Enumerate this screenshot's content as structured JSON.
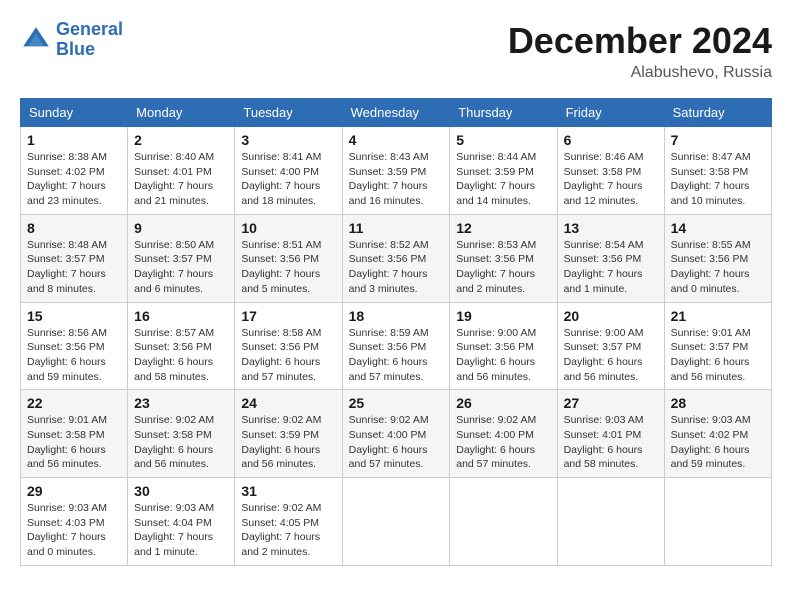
{
  "header": {
    "logo_line1": "General",
    "logo_line2": "Blue",
    "month": "December 2024",
    "location": "Alabushevo, Russia"
  },
  "days_of_week": [
    "Sunday",
    "Monday",
    "Tuesday",
    "Wednesday",
    "Thursday",
    "Friday",
    "Saturday"
  ],
  "weeks": [
    [
      {
        "num": "1",
        "info": "Sunrise: 8:38 AM\nSunset: 4:02 PM\nDaylight: 7 hours\nand 23 minutes."
      },
      {
        "num": "2",
        "info": "Sunrise: 8:40 AM\nSunset: 4:01 PM\nDaylight: 7 hours\nand 21 minutes."
      },
      {
        "num": "3",
        "info": "Sunrise: 8:41 AM\nSunset: 4:00 PM\nDaylight: 7 hours\nand 18 minutes."
      },
      {
        "num": "4",
        "info": "Sunrise: 8:43 AM\nSunset: 3:59 PM\nDaylight: 7 hours\nand 16 minutes."
      },
      {
        "num": "5",
        "info": "Sunrise: 8:44 AM\nSunset: 3:59 PM\nDaylight: 7 hours\nand 14 minutes."
      },
      {
        "num": "6",
        "info": "Sunrise: 8:46 AM\nSunset: 3:58 PM\nDaylight: 7 hours\nand 12 minutes."
      },
      {
        "num": "7",
        "info": "Sunrise: 8:47 AM\nSunset: 3:58 PM\nDaylight: 7 hours\nand 10 minutes."
      }
    ],
    [
      {
        "num": "8",
        "info": "Sunrise: 8:48 AM\nSunset: 3:57 PM\nDaylight: 7 hours\nand 8 minutes."
      },
      {
        "num": "9",
        "info": "Sunrise: 8:50 AM\nSunset: 3:57 PM\nDaylight: 7 hours\nand 6 minutes."
      },
      {
        "num": "10",
        "info": "Sunrise: 8:51 AM\nSunset: 3:56 PM\nDaylight: 7 hours\nand 5 minutes."
      },
      {
        "num": "11",
        "info": "Sunrise: 8:52 AM\nSunset: 3:56 PM\nDaylight: 7 hours\nand 3 minutes."
      },
      {
        "num": "12",
        "info": "Sunrise: 8:53 AM\nSunset: 3:56 PM\nDaylight: 7 hours\nand 2 minutes."
      },
      {
        "num": "13",
        "info": "Sunrise: 8:54 AM\nSunset: 3:56 PM\nDaylight: 7 hours\nand 1 minute."
      },
      {
        "num": "14",
        "info": "Sunrise: 8:55 AM\nSunset: 3:56 PM\nDaylight: 7 hours\nand 0 minutes."
      }
    ],
    [
      {
        "num": "15",
        "info": "Sunrise: 8:56 AM\nSunset: 3:56 PM\nDaylight: 6 hours\nand 59 minutes."
      },
      {
        "num": "16",
        "info": "Sunrise: 8:57 AM\nSunset: 3:56 PM\nDaylight: 6 hours\nand 58 minutes."
      },
      {
        "num": "17",
        "info": "Sunrise: 8:58 AM\nSunset: 3:56 PM\nDaylight: 6 hours\nand 57 minutes."
      },
      {
        "num": "18",
        "info": "Sunrise: 8:59 AM\nSunset: 3:56 PM\nDaylight: 6 hours\nand 57 minutes."
      },
      {
        "num": "19",
        "info": "Sunrise: 9:00 AM\nSunset: 3:56 PM\nDaylight: 6 hours\nand 56 minutes."
      },
      {
        "num": "20",
        "info": "Sunrise: 9:00 AM\nSunset: 3:57 PM\nDaylight: 6 hours\nand 56 minutes."
      },
      {
        "num": "21",
        "info": "Sunrise: 9:01 AM\nSunset: 3:57 PM\nDaylight: 6 hours\nand 56 minutes."
      }
    ],
    [
      {
        "num": "22",
        "info": "Sunrise: 9:01 AM\nSunset: 3:58 PM\nDaylight: 6 hours\nand 56 minutes."
      },
      {
        "num": "23",
        "info": "Sunrise: 9:02 AM\nSunset: 3:58 PM\nDaylight: 6 hours\nand 56 minutes."
      },
      {
        "num": "24",
        "info": "Sunrise: 9:02 AM\nSunset: 3:59 PM\nDaylight: 6 hours\nand 56 minutes."
      },
      {
        "num": "25",
        "info": "Sunrise: 9:02 AM\nSunset: 4:00 PM\nDaylight: 6 hours\nand 57 minutes."
      },
      {
        "num": "26",
        "info": "Sunrise: 9:02 AM\nSunset: 4:00 PM\nDaylight: 6 hours\nand 57 minutes."
      },
      {
        "num": "27",
        "info": "Sunrise: 9:03 AM\nSunset: 4:01 PM\nDaylight: 6 hours\nand 58 minutes."
      },
      {
        "num": "28",
        "info": "Sunrise: 9:03 AM\nSunset: 4:02 PM\nDaylight: 6 hours\nand 59 minutes."
      }
    ],
    [
      {
        "num": "29",
        "info": "Sunrise: 9:03 AM\nSunset: 4:03 PM\nDaylight: 7 hours\nand 0 minutes."
      },
      {
        "num": "30",
        "info": "Sunrise: 9:03 AM\nSunset: 4:04 PM\nDaylight: 7 hours\nand 1 minute."
      },
      {
        "num": "31",
        "info": "Sunrise: 9:02 AM\nSunset: 4:05 PM\nDaylight: 7 hours\nand 2 minutes."
      },
      null,
      null,
      null,
      null
    ]
  ]
}
